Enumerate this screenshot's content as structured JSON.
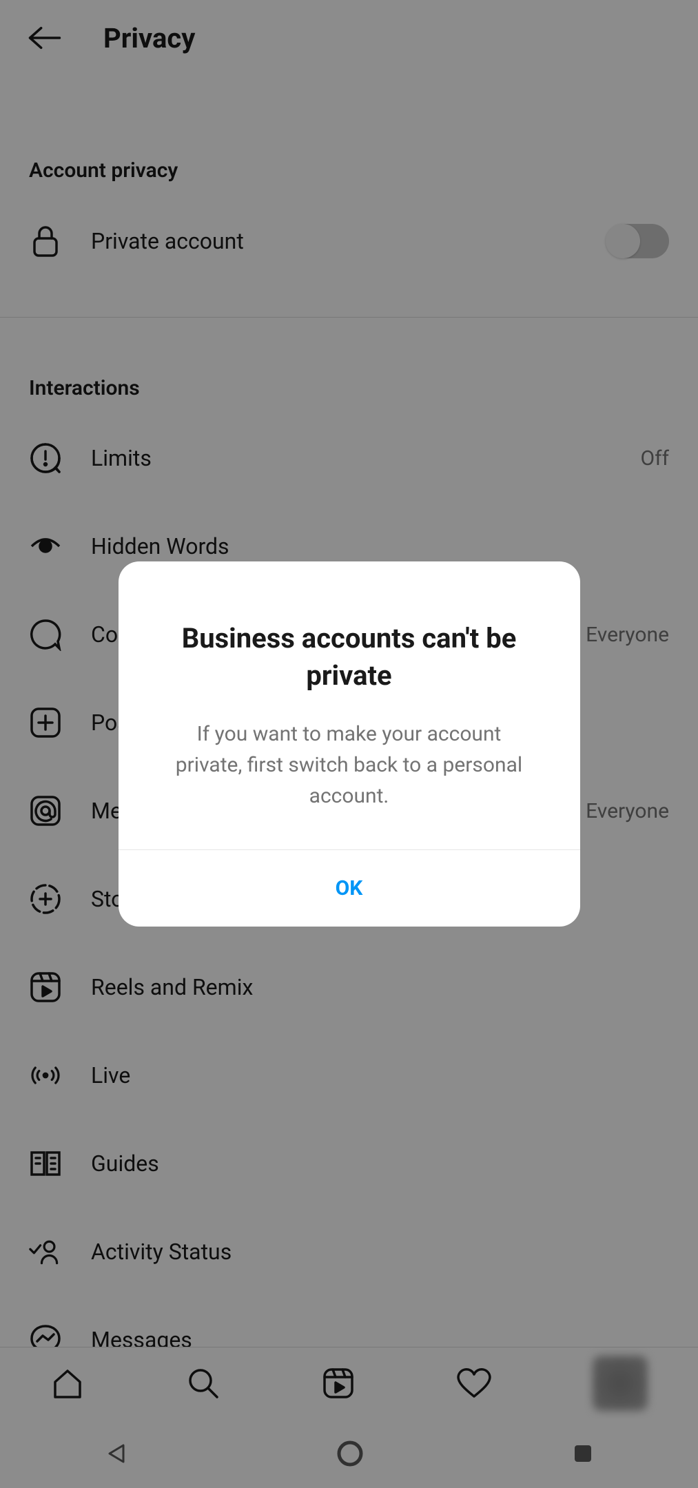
{
  "header": {
    "title": "Privacy"
  },
  "sections": {
    "account_privacy": {
      "title": "Account privacy",
      "private_account_label": "Private account",
      "private_account_on": false
    },
    "interactions": {
      "title": "Interactions",
      "items": {
        "limits": {
          "label": "Limits",
          "value": "Off"
        },
        "hidden_words": {
          "label": "Hidden Words"
        },
        "comments": {
          "label": "Comments",
          "value": "Everyone"
        },
        "posts": {
          "label": "Posts"
        },
        "mentions": {
          "label": "Mentions",
          "value": "Everyone"
        },
        "story": {
          "label": "Story"
        },
        "reels": {
          "label": "Reels and Remix"
        },
        "live": {
          "label": "Live"
        },
        "guides": {
          "label": "Guides"
        },
        "activity_status": {
          "label": "Activity Status"
        },
        "messages": {
          "label": "Messages"
        }
      }
    }
  },
  "dialog": {
    "title": "Business accounts can't be private",
    "body": "If you want to make your account private, first switch back to a personal account.",
    "ok_label": "OK"
  },
  "colors": {
    "accent": "#0095f6",
    "text_primary": "#1a1a1a",
    "text_secondary": "#737373"
  }
}
